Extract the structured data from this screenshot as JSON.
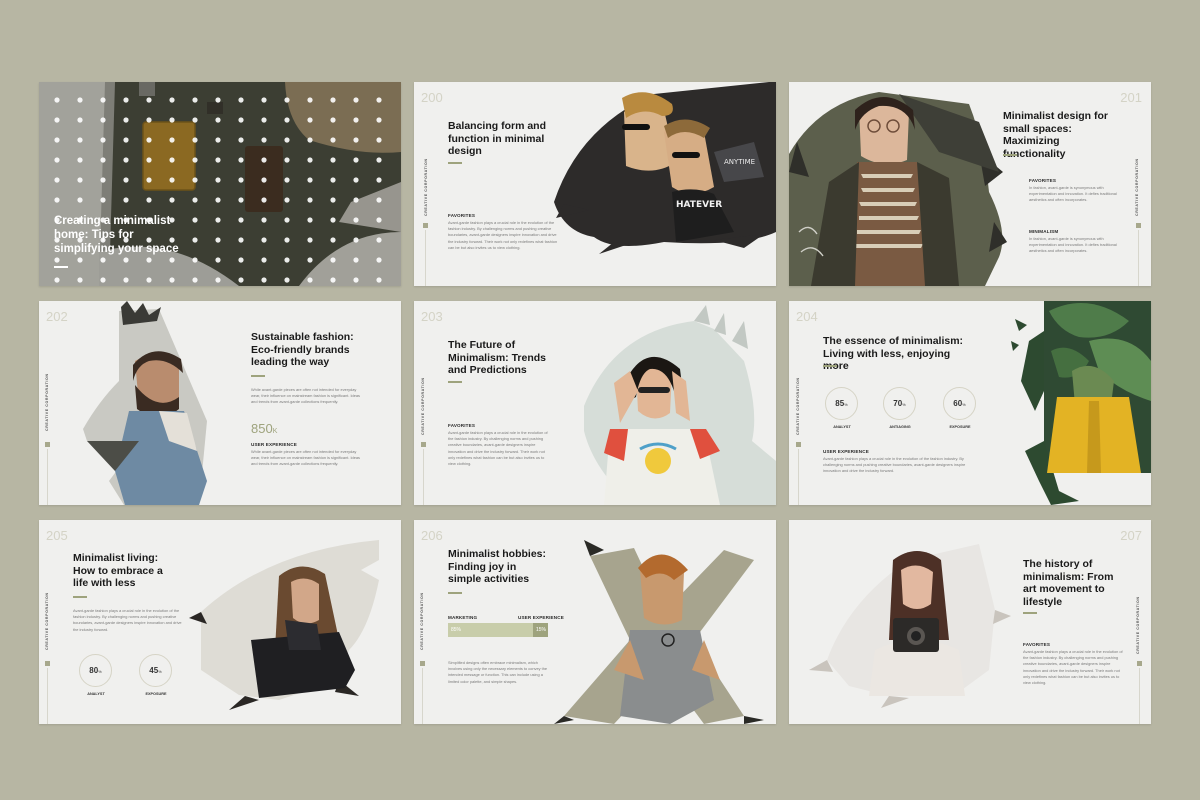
{
  "side_label": "CREATIVE CORPORATION",
  "slides": {
    "s1": {
      "title": "Creating a minimalist home: Tips for simplifying your space"
    },
    "s200": {
      "number": "200",
      "title": "Balancing form and function in minimal design",
      "label": "FAVORITES",
      "body": "Avant-garde fashion plays a crucial role in the evolution of the fashion industry. By challenging norms and pushing creative boundaries, avant-garde designers inspire innovation and drive the industry forward. Their work not only redefines what fashion can be but also invites us to view clothing."
    },
    "s201": {
      "number": "201",
      "title": "Minimalist design for small spaces: Maximizing functionality",
      "label1": "FAVORITES",
      "body1": "In fashion, avant-garde is synonymous with experimentation and innovation. It defies traditional aesthetics and often incorporates.",
      "label2": "MINIMALISM",
      "body2": "In fashion, avant-garde is synonymous with experimentation and innovation. It defies traditional aesthetics and often incorporates."
    },
    "s202": {
      "number": "202",
      "title": "Sustainable fashion: Eco-friendly brands leading the way",
      "body1": "While avant-garde pieces are often not intended for everyday wear, their influence on mainstream fashion is significant. Ideas and trends from avant-garde collections frequently.",
      "stat": "850",
      "stat_unit": "K",
      "label": "USER EXPERIENCE",
      "body2": "While avant-garde pieces are often not intended for everyday wear, their influence on mainstream fashion is significant. Ideas and trends from avant-garde collections frequently."
    },
    "s203": {
      "number": "203",
      "title": "The Future of Minimalism: Trends and Predictions",
      "label": "FAVORITES",
      "body": "Avant-garde fashion plays a crucial role in the evolution of the fashion industry. By challenging norms and pushing creative boundaries, avant-garde designers inspire innovation and drive the industry forward. Their work not only redefines what fashion can be but also invites us to view clothing."
    },
    "s204": {
      "number": "204",
      "title": "The essence of minimalism: Living with less, enjoying more",
      "rings": [
        {
          "value": "85",
          "label": "ANALYST"
        },
        {
          "value": "70",
          "label": "ANTIAGING"
        },
        {
          "value": "60",
          "label": "EXPOSURE"
        }
      ],
      "label": "USER EXPERIENCE",
      "body": "Avant-garde fashion plays a crucial role in the evolution of the fashion industry. By challenging norms and pushing creative boundaries, avant-garde designers inspire innovation and drive the industry forward."
    },
    "s205": {
      "number": "205",
      "title": "Minimalist living: How to embrace a life with less",
      "body": "Avant-garde fashion plays a crucial role in the evolution of the fashion industry. By challenging norms and pushing creative boundaries, avant-garde designers inspire innovation and drive the industry forward.",
      "rings": [
        {
          "value": "80",
          "label": "ANALYST"
        },
        {
          "value": "45",
          "label": "EXPOSURE"
        }
      ]
    },
    "s206": {
      "number": "206",
      "title": "Minimalist hobbies: Finding joy in simple activities",
      "bar_left_label": "MARKETING",
      "bar_right_label": "USER EXPERIENCE",
      "bar_left_value": "85%",
      "bar_right_value": "15%",
      "body": "Simplified designs often embrace minimalism, which involves using only the necessary elements to convey the intended message or function. This can include using a limited color palette, and simple shapes."
    },
    "s207": {
      "number": "207",
      "title": "The history of minimalism: From art movement to lifestyle",
      "label": "FAVORITES",
      "body": "Avant-garde fashion plays a crucial role in the evolution of the fashion industry. By challenging norms and pushing creative boundaries, avant-garde designers inspire innovation and drive the industry forward. Their work not only redefines what fashion can be but also invites us to view clothing."
    }
  }
}
